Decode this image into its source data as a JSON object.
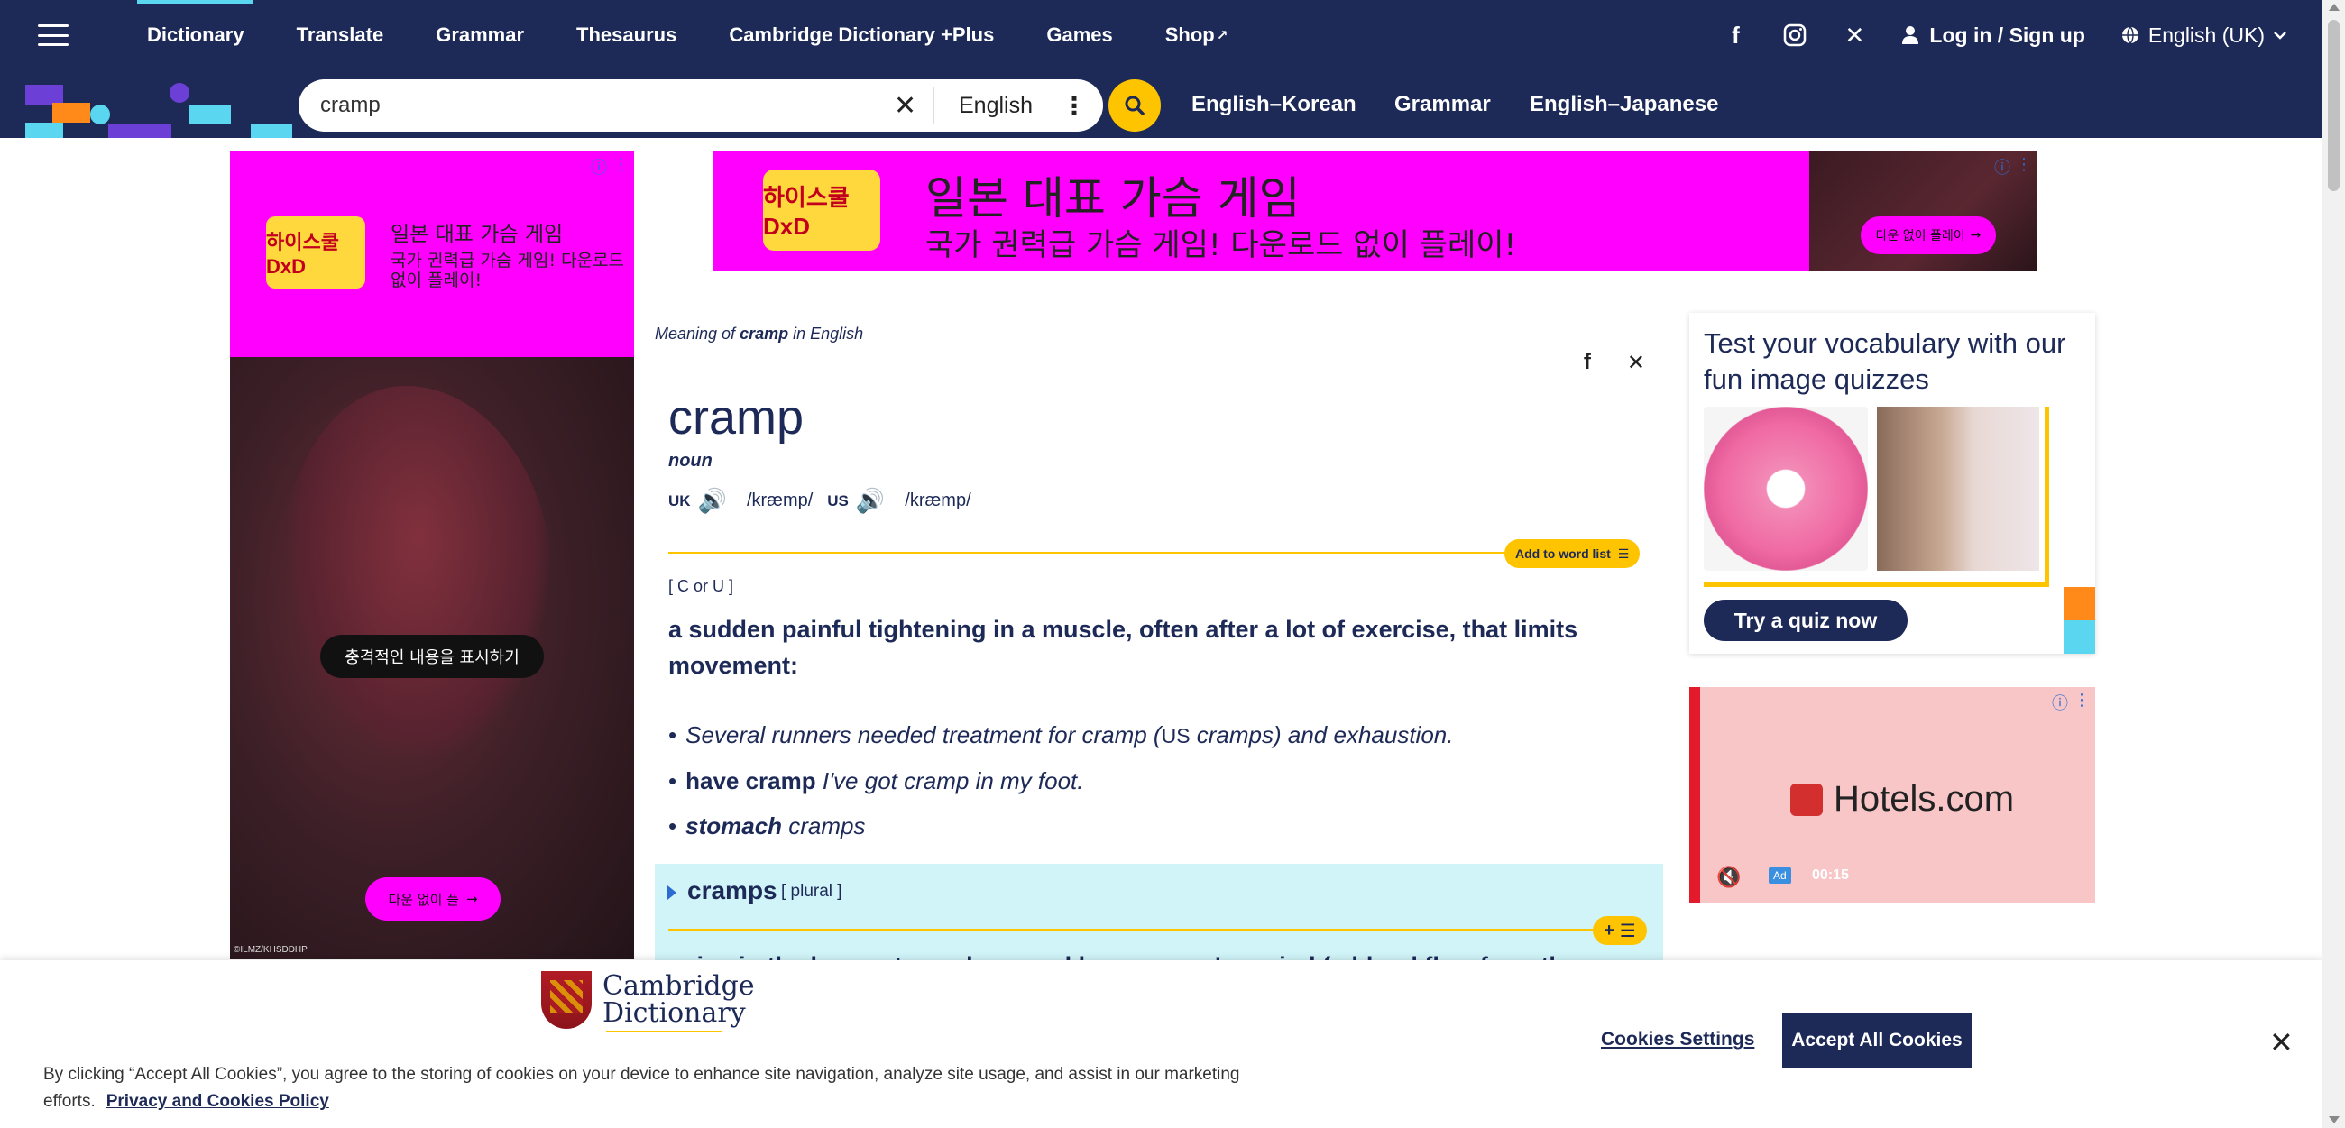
{
  "nav": {
    "items": [
      "Dictionary",
      "Translate",
      "Grammar",
      "Thesaurus",
      "Cambridge Dictionary +Plus",
      "Games",
      "Shop"
    ],
    "active": "Dictionary",
    "shop_external_icon": "external-link-icon",
    "social": [
      "facebook-icon",
      "instagram-icon",
      "x-icon"
    ],
    "login_label": "Log in / Sign up",
    "language": "English (UK)"
  },
  "search": {
    "value": "cramp",
    "dictionary": "English",
    "quick_links": [
      "English–Korean",
      "Grammar",
      "English–Japanese"
    ]
  },
  "ads": {
    "top": {
      "logo": "하이스쿨 DxD",
      "headline": "일본 대표 가슴 게임",
      "subline": "국가 권력급 가슴 게임! 다운로드 없이 플레이!",
      "thumb_button": "다운 없이 플레이"
    },
    "left": {
      "logo": "하이스쿨 DxD",
      "headline": "일본 대표 가슴 게임",
      "subline": "국가 권력급 가슴 게임! 다운로드 없이 플레이!",
      "reveal_button": "충격적인 내용을 표시하기",
      "download_button": "다운 없이 플",
      "copyright": "©ILMZ/KHSDDHP"
    },
    "right": {
      "brand": "Hotels.com",
      "ad_tag": "Ad",
      "timer": "00:15"
    }
  },
  "entry": {
    "meaning_prefix": "Meaning of",
    "meaning_word": "cramp",
    "meaning_suffix": "in English",
    "headword": "cramp",
    "pos": "noun",
    "uk_label": "UK",
    "uk_ipa": "/kræmp/",
    "us_label": "US",
    "us_ipa": "/kræmp/",
    "add_to_list": "Add to word list",
    "grammar_tag": "[ C or U ]",
    "definition": "a sudden painful tightening in a muscle, often after a lot of exercise, that limits movement:",
    "examples": [
      {
        "pre": "Several runners needed treatment for cramp (",
        "us": "US",
        "post": " cramps) and exhaustion."
      },
      {
        "bold": "have cramp",
        "text": " I've got cramp in my foot."
      },
      {
        "bold": "stomach",
        "text": " cramps"
      }
    ],
    "sense": {
      "word": "cramps",
      "tag": "[ plural ]",
      "plus_label": "+",
      "cut_definition": "pains in the lower stomach caused by a person's period (= blood flow from the"
    }
  },
  "quiz": {
    "title": "Test your vocabulary with our fun image quizzes",
    "button": "Try a quiz now"
  },
  "cookie": {
    "brand_line1": "Cambridge",
    "brand_line2": "Dictionary",
    "text": "By clicking “Accept All Cookies”, you agree to the storing of cookies on your device to enhance site navigation, analyze site usage, and assist in our marketing efforts.",
    "policy_link": "Privacy and Cookies Policy",
    "settings_label": "Cookies Settings",
    "accept_label": "Accept All Cookies"
  }
}
